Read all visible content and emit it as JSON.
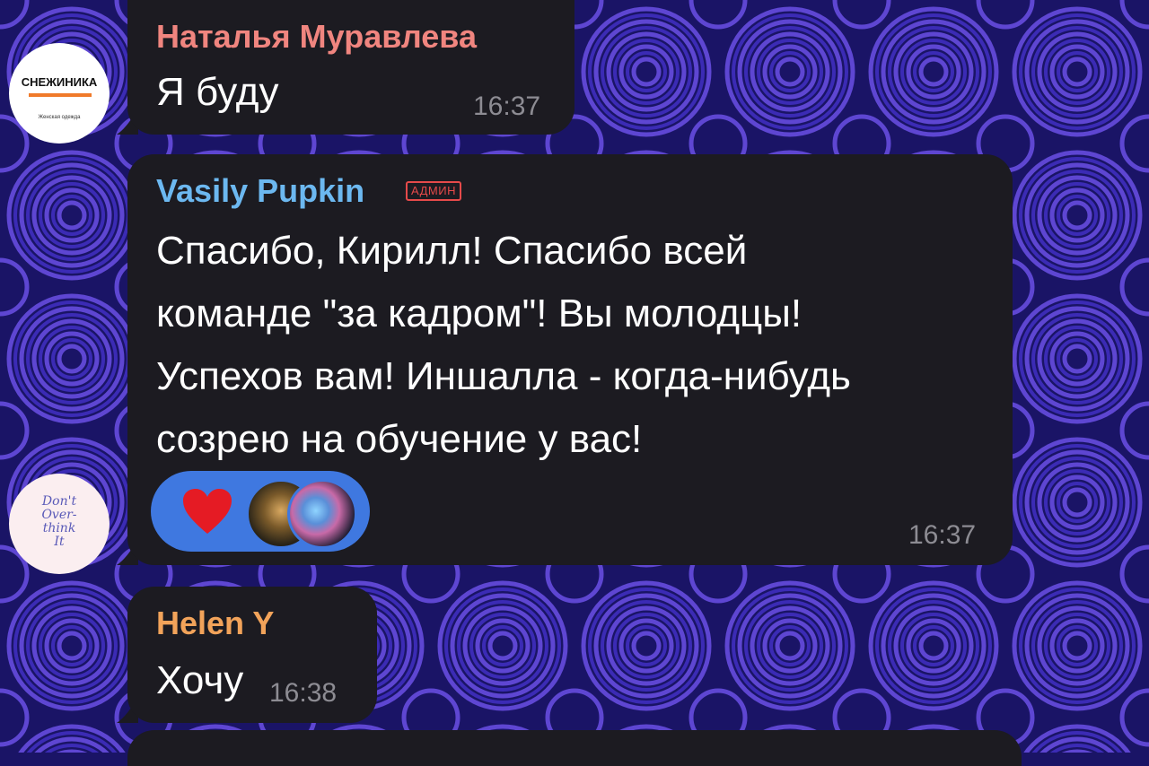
{
  "colors": {
    "bubble": "#1c1b21",
    "time": "#8d8c93",
    "sender_1": "#f0857f",
    "sender_2": "#6cb8f0",
    "sender_3": "#f2a35a",
    "admin_badge": "#e64a4a",
    "reaction_bg": "#3f78e0",
    "background": "#1a1466"
  },
  "messages": [
    {
      "sender": "Наталья Муравлева",
      "avatar": {
        "title": "СНЕЖИНИКА",
        "subtitle": "Женская одежда"
      },
      "text": "Я буду",
      "time": "16:37"
    },
    {
      "sender": "Vasily Pupkin",
      "badge": "АДМИН",
      "avatar": {
        "lines": [
          "Don't",
          "Over-",
          "think",
          "It"
        ]
      },
      "lines": [
        "Спасибо, Кирилл! Спасибо всей",
        "команде \"за кадром\"! Вы молодцы!",
        "Успехов вам! Иншалла - когда-нибудь",
        "созрею на обучение у вас!"
      ],
      "reaction": {
        "emoji": "heart-icon"
      },
      "time": "16:37"
    },
    {
      "sender": "Helen Y",
      "text": "Хочу",
      "time": "16:38"
    }
  ]
}
